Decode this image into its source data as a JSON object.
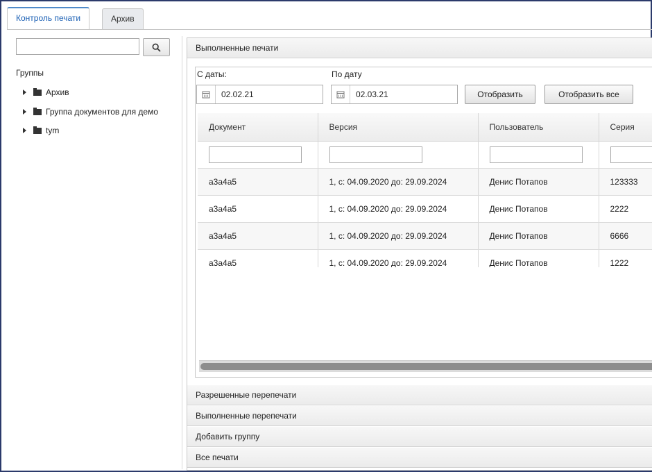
{
  "tabs": [
    {
      "label": "Контроль печати",
      "active": true
    },
    {
      "label": "Архив",
      "active": false
    }
  ],
  "left": {
    "search": {
      "value": "",
      "placeholder": ""
    },
    "groups_title": "Группы",
    "tree": [
      "Архив",
      "Группа документов для демо",
      "tym"
    ]
  },
  "panels": {
    "main_title": "Выполненные печати",
    "collapsed": [
      "Разрешенные перепечати",
      "Выполненные перепечати",
      "Добавить группу",
      "Все печати"
    ]
  },
  "filters": {
    "from_label": "С даты:",
    "from_value": "02.02.21",
    "to_label": "По дату",
    "to_value": "02.03.21",
    "show_label": "Отобразить",
    "show_all_label": "Отобразить все"
  },
  "grid": {
    "columns": [
      "Документ",
      "Версия",
      "Пользователь",
      "Серия"
    ],
    "rows": [
      [
        "а3а4а5",
        "1, с: 04.09.2020 до: 29.09.2024",
        "Денис Потапов",
        "123333"
      ],
      [
        "а3а4а5",
        "1, с: 04.09.2020 до: 29.09.2024",
        "Денис Потапов",
        "2222"
      ],
      [
        "а3а4а5",
        "1, с: 04.09.2020 до: 29.09.2024",
        "Денис Потапов",
        "6666"
      ],
      [
        "а3а4а5",
        "1, с: 04.09.2020 до: 29.09.2024",
        "Денис Потапов",
        "1222"
      ]
    ]
  },
  "icons": {
    "search": "search-icon",
    "calendar": "calendar-icon",
    "folder": "folder-icon",
    "expand": "chevron-right-icon"
  }
}
